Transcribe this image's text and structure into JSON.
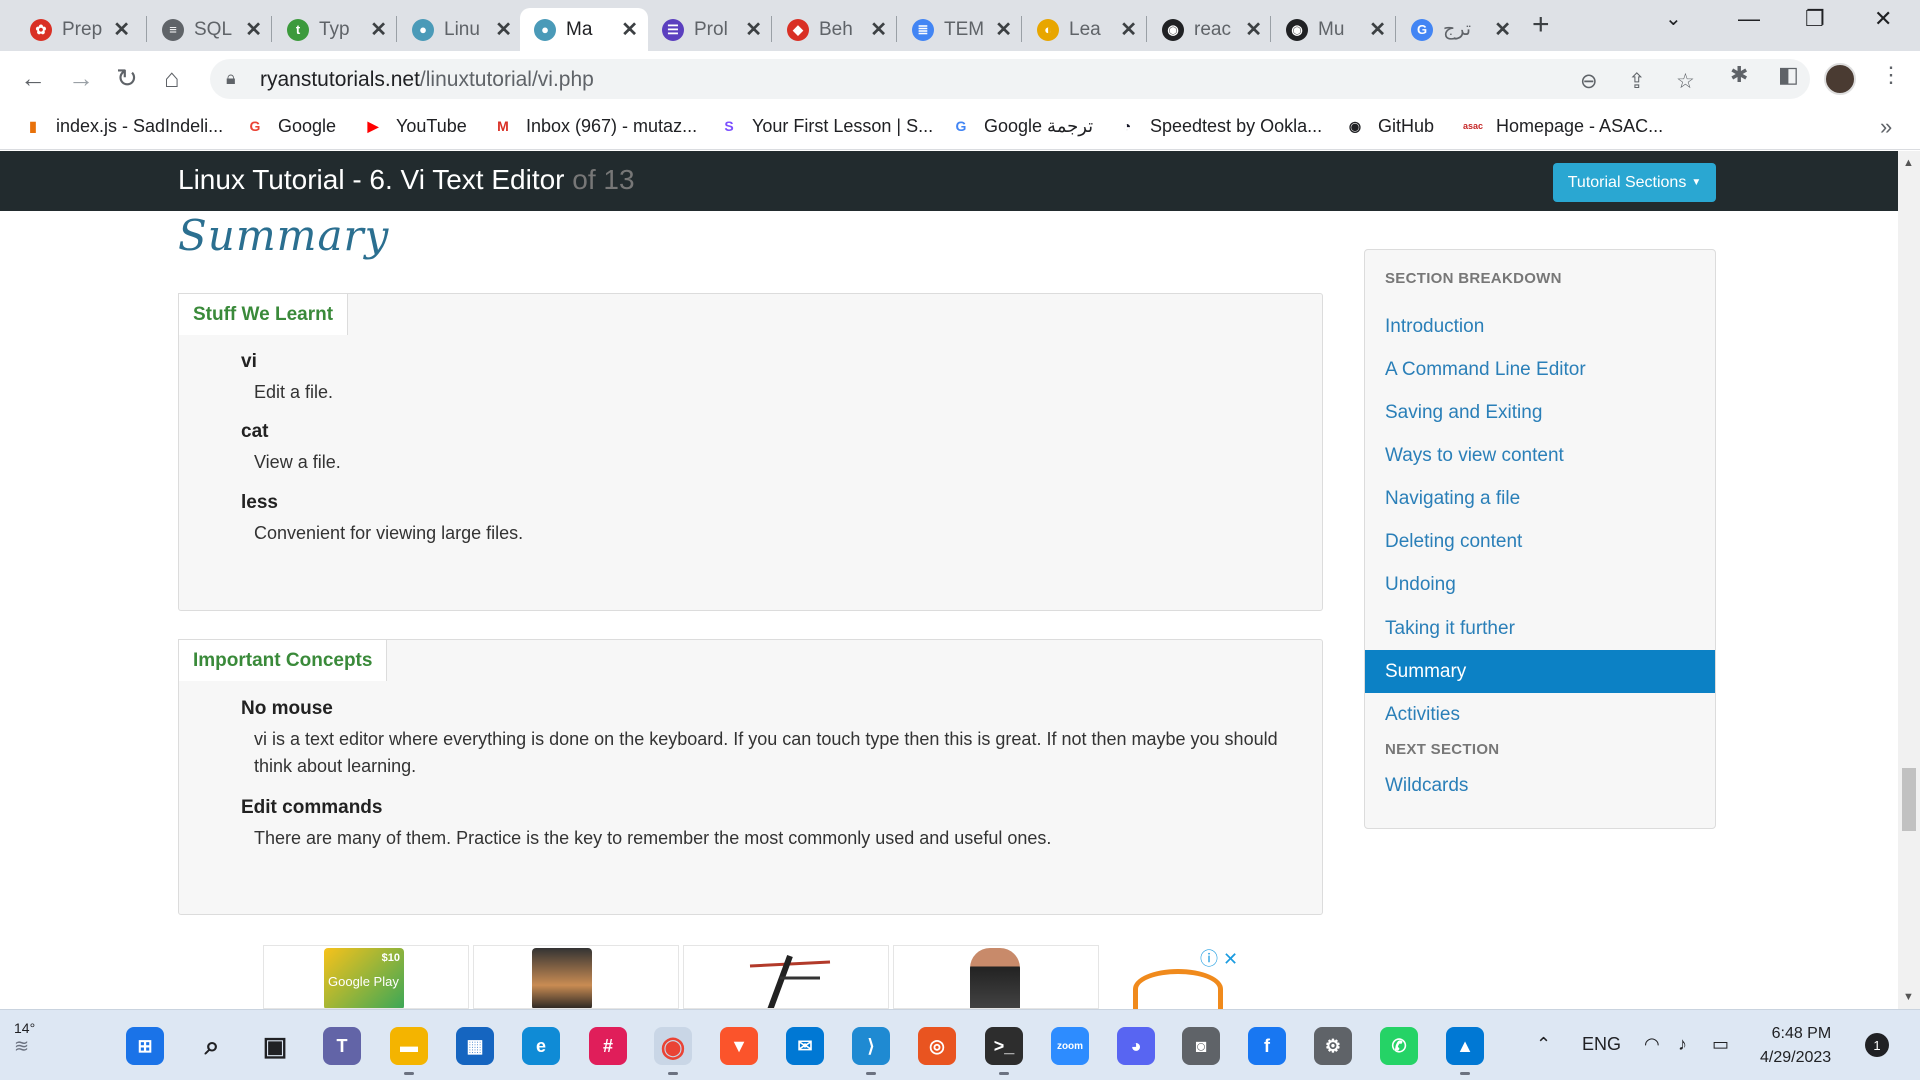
{
  "browser": {
    "tabs": [
      {
        "title": "Prep",
        "color": "#d93025",
        "glyph": "✿"
      },
      {
        "title": "SQL",
        "color": "#5f6368",
        "glyph": "≡"
      },
      {
        "title": "Typ",
        "color": "#3c9a3c",
        "glyph": "t"
      },
      {
        "title": "Linu",
        "color": "#4a9ab8",
        "glyph": "●"
      },
      {
        "title": "Ma",
        "color": "#4a9ab8",
        "glyph": "●"
      },
      {
        "title": "Prol",
        "color": "#5b3fbf",
        "glyph": "☰"
      },
      {
        "title": "Beh",
        "color": "#d93025",
        "glyph": "◆"
      },
      {
        "title": "TEM",
        "color": "#4285f4",
        "glyph": "≣"
      },
      {
        "title": "Lea",
        "color": "#e8a600",
        "glyph": "◐"
      },
      {
        "title": "reac",
        "color": "#202124",
        "glyph": "◉"
      },
      {
        "title": "Mu",
        "color": "#202124",
        "glyph": "◉"
      },
      {
        "title": "ترج",
        "color": "#4285f4",
        "glyph": "G"
      }
    ],
    "active_tab_index": 4,
    "url_domain": "ryanstutorials.net",
    "url_path": "/linuxtutorial/vi.php",
    "bookmarks": [
      {
        "label": "index.js - SadIndeli...",
        "color": "#e8710a",
        "glyph": "▮"
      },
      {
        "label": "Google",
        "color": "#ea4335",
        "glyph": "G"
      },
      {
        "label": "YouTube",
        "color": "#ff0000",
        "glyph": "▶"
      },
      {
        "label": "Inbox (967) - mutaz...",
        "color": "#d93025",
        "glyph": "M"
      },
      {
        "label": "Your First Lesson | S...",
        "color": "#7b4fff",
        "glyph": "S"
      },
      {
        "label": "Google ترجمة",
        "color": "#4285f4",
        "glyph": "G"
      },
      {
        "label": "Speedtest by Ookla...",
        "color": "#141526",
        "glyph": "◔"
      },
      {
        "label": "GitHub",
        "color": "#202124",
        "glyph": "◉"
      },
      {
        "label": "Homepage - ASAC...",
        "color": "#c62828",
        "glyph": "asac"
      }
    ]
  },
  "page": {
    "brand": "Linux Tutorial - 6. Vi Text Editor",
    "brand_of": "of 13",
    "sections_button": "Tutorial Sections",
    "heading": "Summary",
    "learnt_title": "Stuff We Learnt",
    "learnt": [
      {
        "term": "vi",
        "desc": "Edit a file."
      },
      {
        "term": "cat",
        "desc": "View a file."
      },
      {
        "term": "less",
        "desc": "Convenient for viewing large files."
      }
    ],
    "concepts_title": "Important Concepts",
    "concepts": [
      {
        "term": "No mouse",
        "desc": "vi is a text editor where everything is done on the keyboard. If you can touch type then this is great. If not then maybe you should think about learning."
      },
      {
        "term": "Edit commands",
        "desc": "There are many of them. Practice is the key to remember the most commonly used and useful ones."
      }
    ],
    "sidebar": {
      "header": "SECTION BREAKDOWN",
      "items": [
        "Introduction",
        "A Command Line Editor",
        "Saving and Exiting",
        "Ways to view content",
        "Navigating a file",
        "Deleting content",
        "Undoing",
        "Taking it further",
        "Summary",
        "Activities"
      ],
      "active_index": 8,
      "next_header": "NEXT SECTION",
      "next_item": "Wildcards"
    },
    "ad_google_play_label": "Google Play",
    "ad_price": "$10"
  },
  "taskbar": {
    "temperature": "14°",
    "language": "ENG",
    "time": "6:48 PM",
    "date": "4/29/2023",
    "notifications": "1",
    "apps": [
      {
        "name": "start",
        "color": "#1a73e8",
        "glyph": "⊞"
      },
      {
        "name": "search",
        "color": "#202124",
        "glyph": "⌕"
      },
      {
        "name": "task-view",
        "color": "#202124",
        "glyph": "▣"
      },
      {
        "name": "teams",
        "color": "#6264a7",
        "glyph": "T"
      },
      {
        "name": "file-explorer",
        "color": "#f4b400",
        "glyph": "▬"
      },
      {
        "name": "store",
        "color": "#1565c0",
        "glyph": "▦"
      },
      {
        "name": "edge",
        "color": "#0f8bd6",
        "glyph": "e"
      },
      {
        "name": "slack",
        "color": "#e01e5a",
        "glyph": "#"
      },
      {
        "name": "chrome",
        "color": "#ea4335",
        "glyph": "◉"
      },
      {
        "name": "brave",
        "color": "#fb542b",
        "glyph": "▼"
      },
      {
        "name": "mail",
        "color": "#0078d4",
        "glyph": "✉"
      },
      {
        "name": "vscode",
        "color": "#1f8ad2",
        "glyph": "⟩"
      },
      {
        "name": "ubuntu",
        "color": "#e95420",
        "glyph": "◎"
      },
      {
        "name": "terminal",
        "color": "#2d2d2d",
        "glyph": ">_"
      },
      {
        "name": "zoom",
        "color": "#2d8cff",
        "glyph": "zoom"
      },
      {
        "name": "discord",
        "color": "#5865f2",
        "glyph": "◕"
      },
      {
        "name": "camera",
        "color": "#5f6368",
        "glyph": "◙"
      },
      {
        "name": "facebook",
        "color": "#1877f2",
        "glyph": "f"
      },
      {
        "name": "settings",
        "color": "#5f6368",
        "glyph": "⚙"
      },
      {
        "name": "whatsapp",
        "color": "#25d366",
        "glyph": "✆"
      },
      {
        "name": "photos",
        "color": "#0078d4",
        "glyph": "▲"
      }
    ]
  }
}
